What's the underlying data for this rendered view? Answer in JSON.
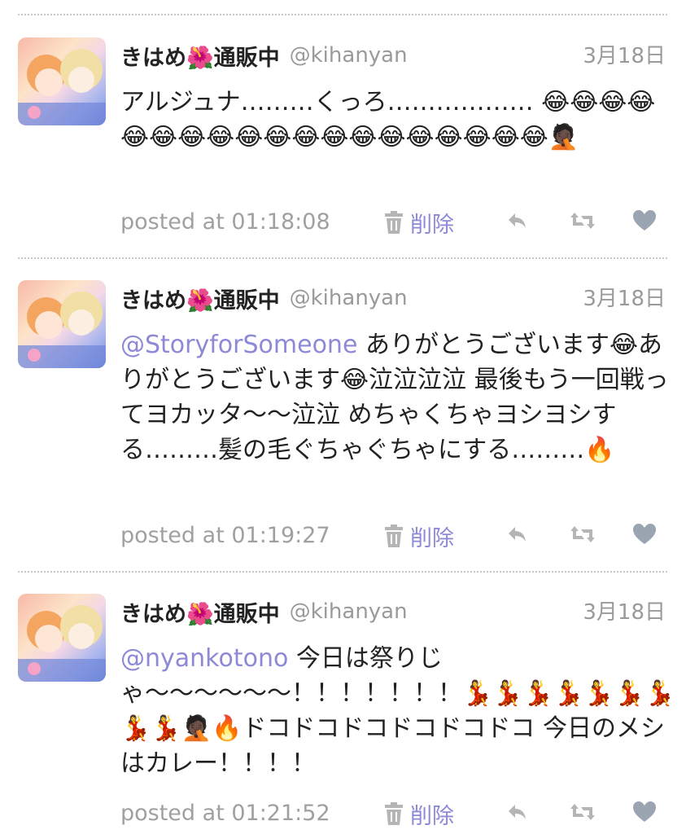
{
  "tweets": [
    {
      "display_name": "きはめ🌺通販中",
      "handle": "@kihanyan",
      "date": "3月18日",
      "mention": "",
      "text": "アルジュナ………くっろ……………… 😂😂😂😂😂😂😂😂😂😂😂😂😂😂😂😂😂😂😂🤦🏿",
      "posted": "posted at 01:18:08",
      "delete_label": "削除"
    },
    {
      "display_name": "きはめ🌺通販中",
      "handle": "@kihanyan",
      "date": "3月18日",
      "mention": "@StoryforSomeone",
      "text": " ありがとうございます😂ありがとうございます😂泣泣泣泣 最後もう一回戦ってヨカッタ〜〜泣泣 めちゃくちゃヨシヨシする………髪の毛ぐちゃぐちゃにする………🔥",
      "posted": "posted at 01:19:27",
      "delete_label": "削除"
    },
    {
      "display_name": "きはめ🌺通販中",
      "handle": "@kihanyan",
      "date": "3月18日",
      "mention": "@nyankotono",
      "text": " 今日は祭りじゃ〜〜〜〜〜〜！！！！！！！💃💃💃💃💃💃💃💃💃🤦🏿🔥ドコドコドコドコドコドコ 今日のメシはカレー！！！！",
      "posted": "posted at 01:21:52",
      "delete_label": "削除"
    }
  ],
  "icons": {
    "delete": "trash-icon",
    "reply": "reply-icon",
    "retweet": "retweet-icon",
    "favorite": "heart-icon"
  },
  "colors": {
    "mention": "#8c8ad6",
    "meta_text": "#a0a0a0",
    "icon_gray": "#b5b5b5",
    "heart": "#9aa5b1"
  }
}
